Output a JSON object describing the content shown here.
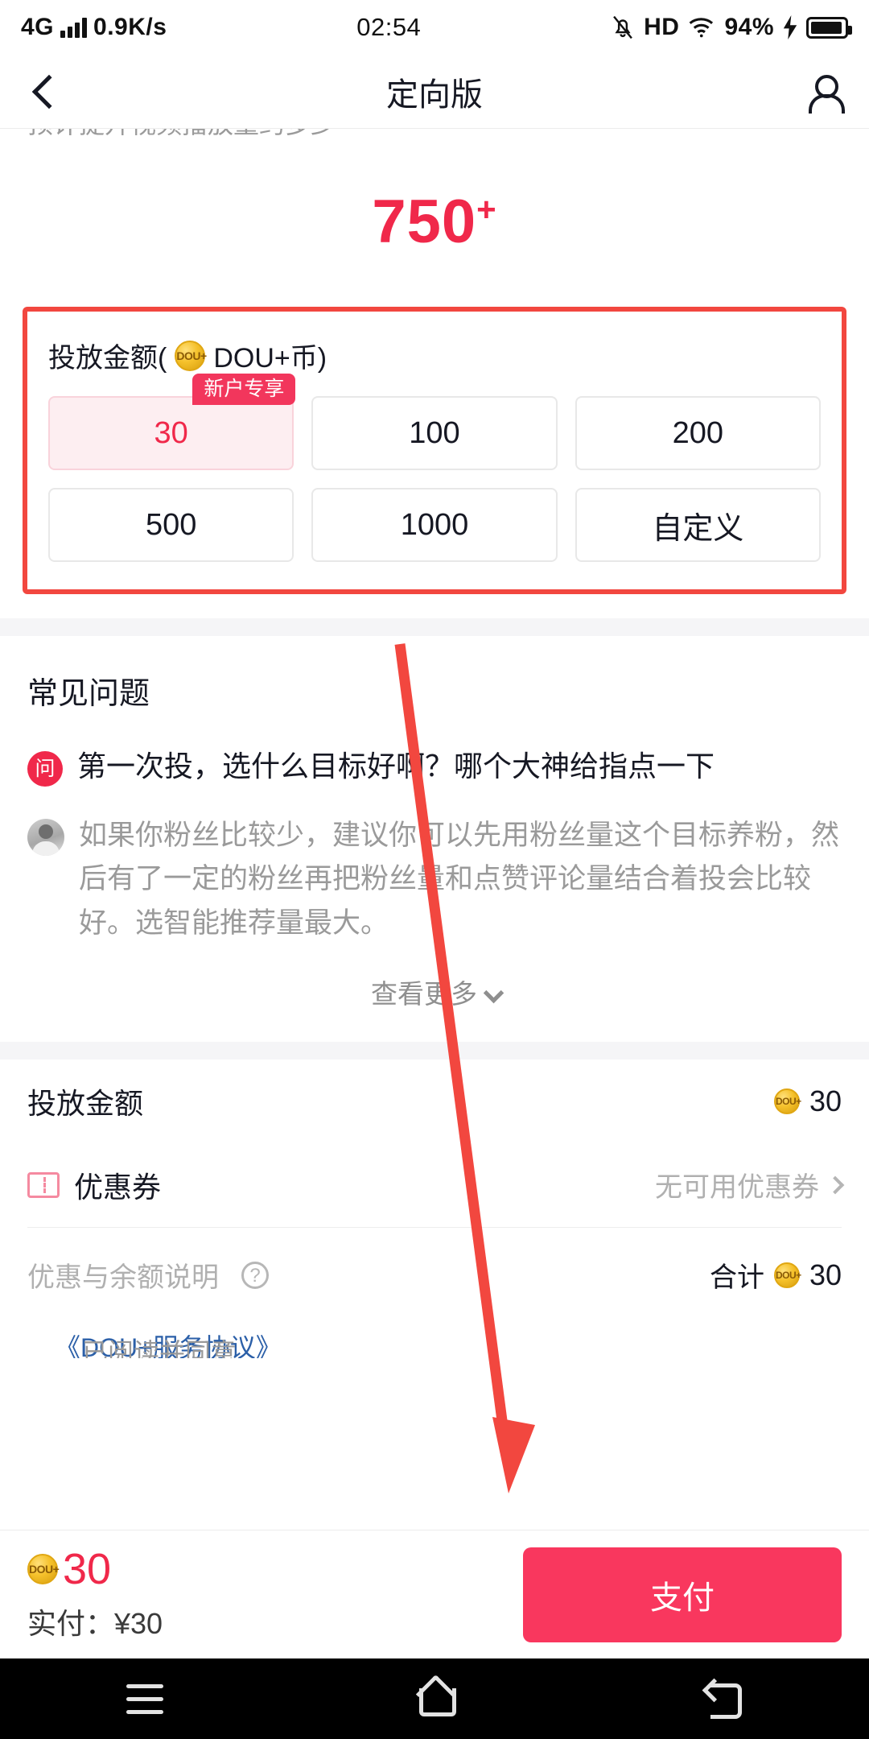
{
  "statusbar": {
    "network": "4G",
    "speed": "0.9K/s",
    "time": "02:54",
    "hd": "HD",
    "battery": "94%"
  },
  "navbar": {
    "title": "定向版",
    "back_icon": "chevron-left-icon",
    "profile_icon": "person-icon"
  },
  "estimate": {
    "clipped_hint": "预计提升视频播放量约多少",
    "value": "750",
    "plus": "+"
  },
  "amount_section": {
    "label_prefix": "投放金额(",
    "coin_text": "DOU+",
    "label_suffix": "DOU+币)",
    "badge": "新户专享",
    "options": [
      {
        "label": "30",
        "selected": true,
        "has_badge": true
      },
      {
        "label": "100",
        "selected": false,
        "has_badge": false
      },
      {
        "label": "200",
        "selected": false,
        "has_badge": false
      },
      {
        "label": "500",
        "selected": false,
        "has_badge": false
      },
      {
        "label": "1000",
        "selected": false,
        "has_badge": false
      },
      {
        "label": "自定义",
        "selected": false,
        "has_badge": false
      }
    ]
  },
  "faq": {
    "title": "常见问题",
    "question_badge": "问",
    "question": "第一次投，选什么目标好啊？哪个大神给指点一下",
    "answer": "如果你粉丝比较少，建议你可以先用粉丝量这个目标养粉，然后有了一定的粉丝再把粉丝量和点赞评论量结合着投会比较好。选智能推荐量最大。",
    "more_label": "查看更多"
  },
  "summary": {
    "amount_label": "投放金额",
    "amount_value": "30",
    "coupon_label": "优惠券",
    "coupon_value": "无可用优惠券",
    "note_label": "优惠与余额说明",
    "total_label": "合计",
    "total_value": "30",
    "agreement_prefix": "已阅读并同意",
    "agreement_link": "《DOU+服务协议》"
  },
  "paybar": {
    "coin_amount": "30",
    "actual_pay": "实付：¥30",
    "pay_button": "支付"
  },
  "androidnav": {
    "recents": "recents-icon",
    "home": "home-icon",
    "back": "back-icon"
  },
  "colors": {
    "accent_pink": "#F0284A",
    "pay_button": "#F9375E",
    "highlight_border": "#F2473F",
    "coin_gold": "#F5C12B",
    "link_blue": "#2B5FA8"
  }
}
